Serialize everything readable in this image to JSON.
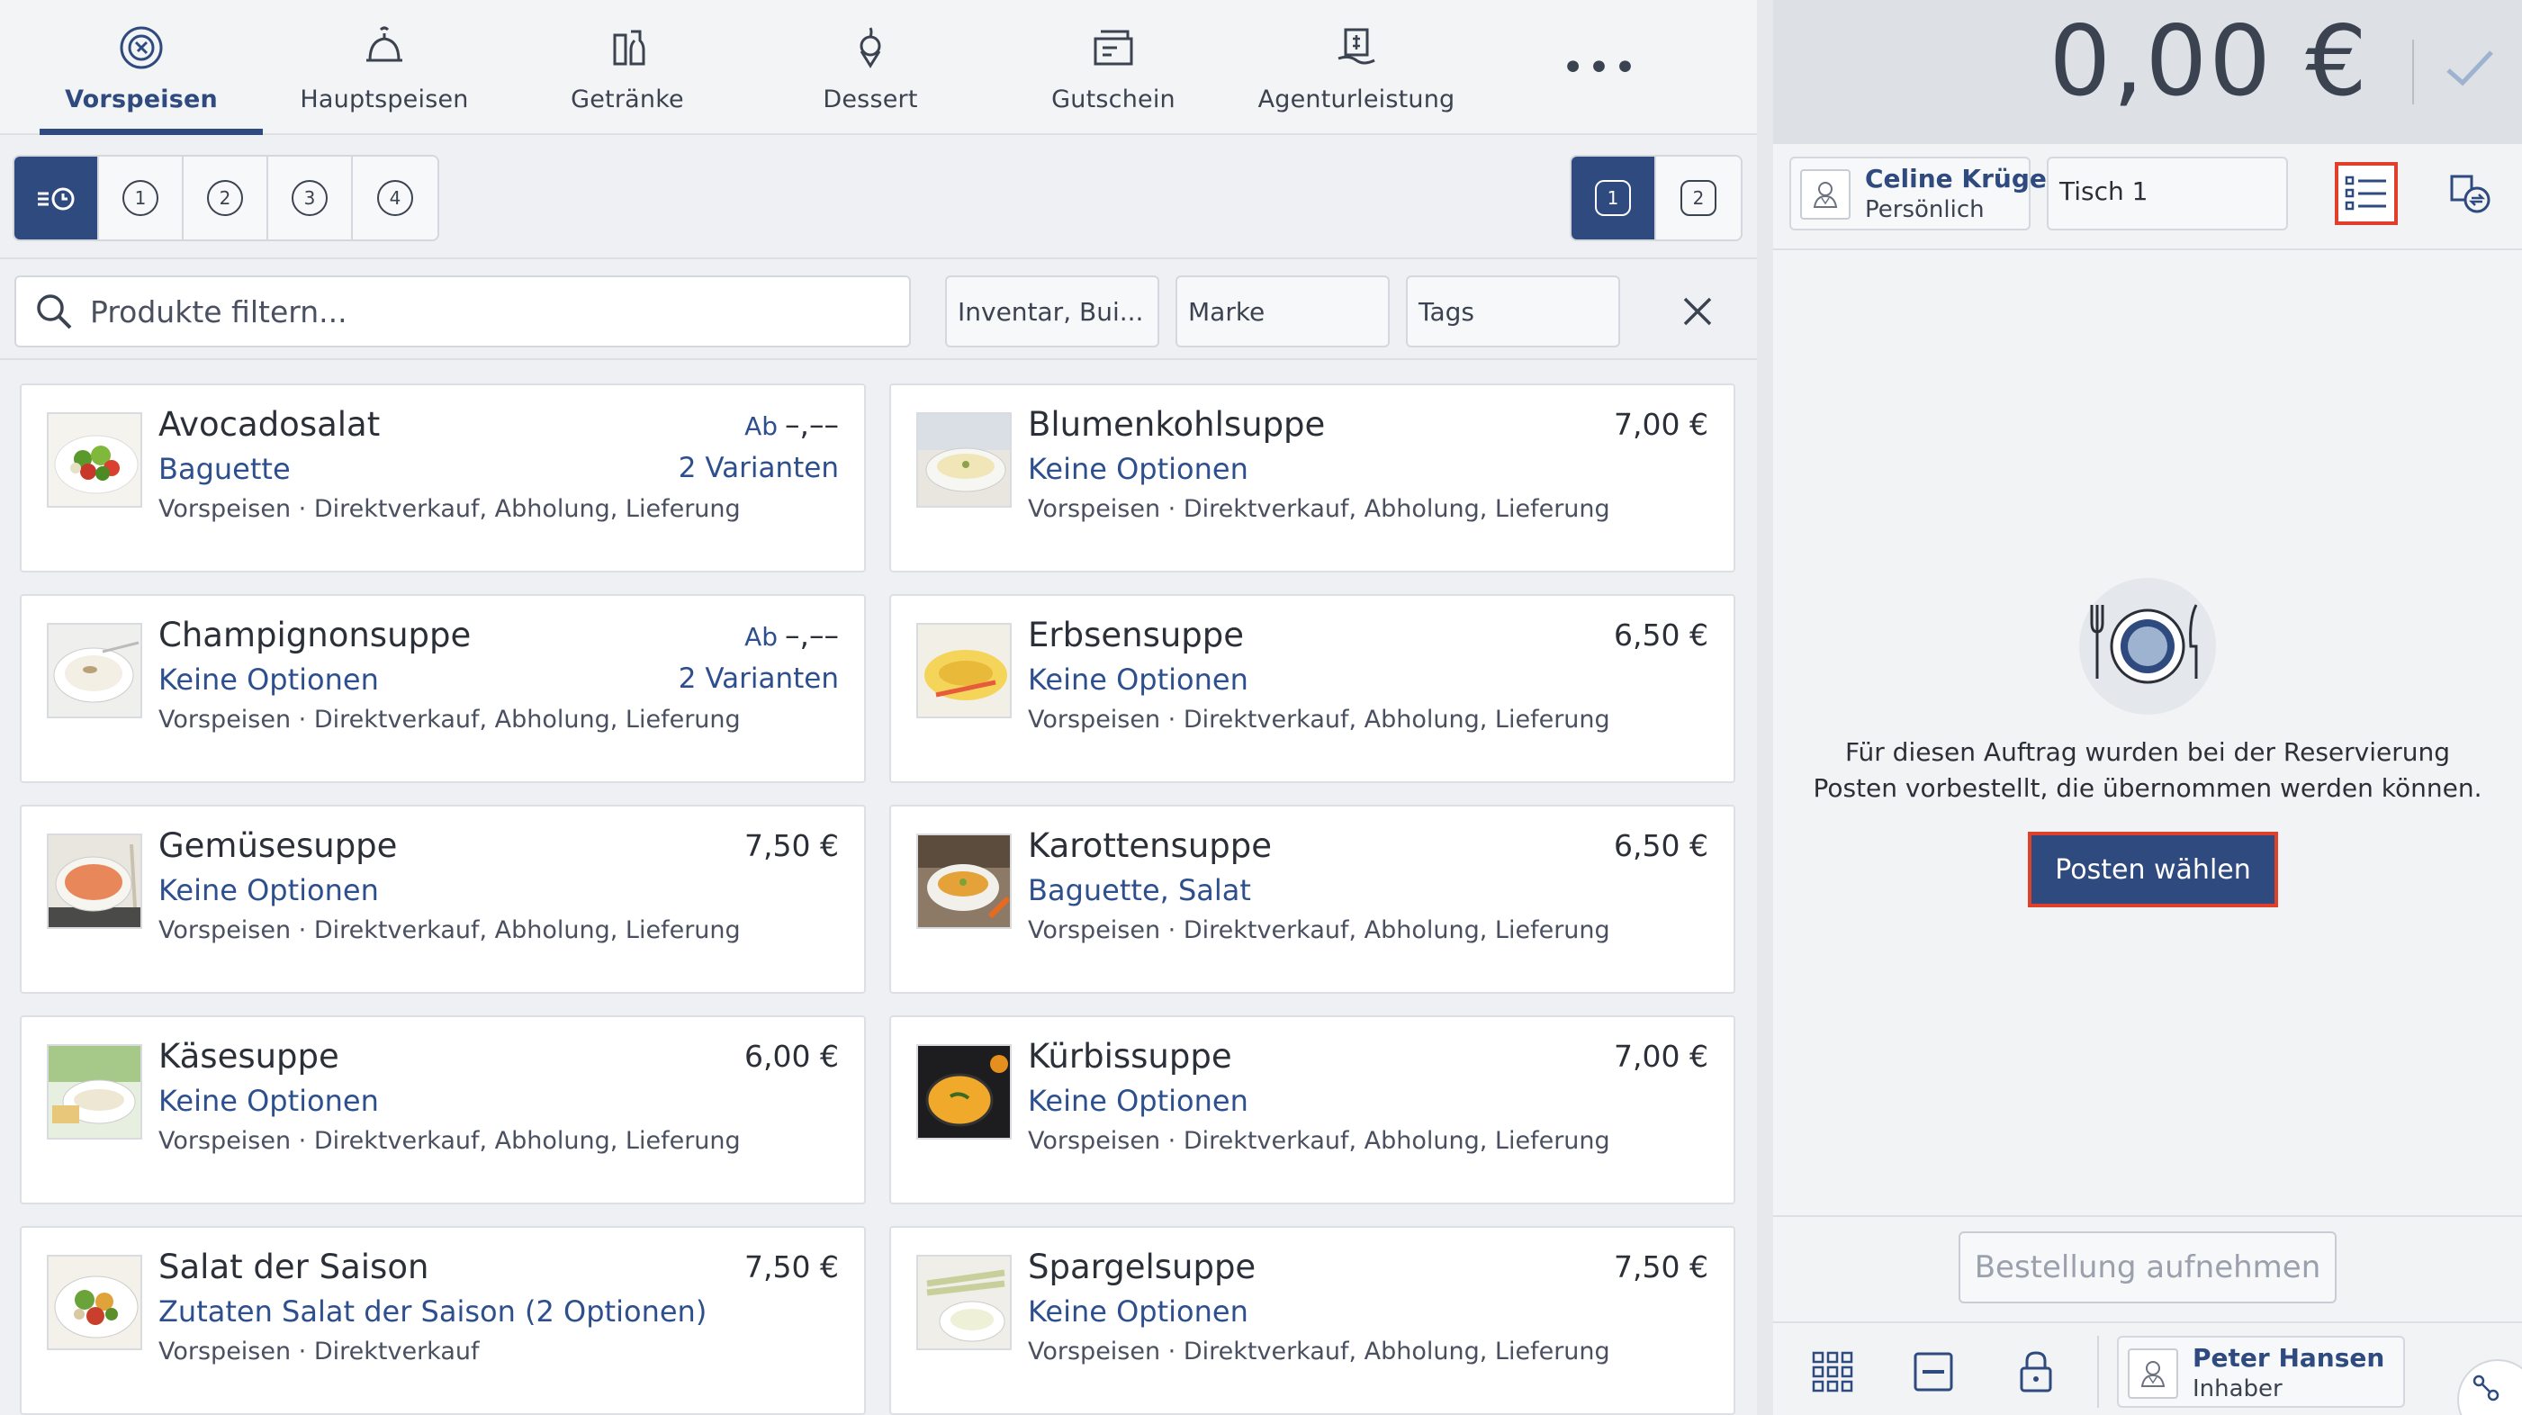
{
  "categories": [
    {
      "label": "Vorspeisen",
      "icon": "plate-icon",
      "active": true
    },
    {
      "label": "Hauptspeisen",
      "icon": "cloche-icon",
      "active": false
    },
    {
      "label": "Getränke",
      "icon": "drinks-icon",
      "active": false
    },
    {
      "label": "Dessert",
      "icon": "dessert-icon",
      "active": false
    },
    {
      "label": "Gutschein",
      "icon": "voucher-icon",
      "active": false
    },
    {
      "label": "Agenturleistung",
      "icon": "agency-service-icon",
      "active": false
    }
  ],
  "more_label": "•••",
  "course_segments": [
    "1",
    "2",
    "3",
    "4"
  ],
  "seat_segments": [
    "1",
    "2"
  ],
  "search": {
    "placeholder": "Produkte filtern..."
  },
  "filters": {
    "inventory": "Inventar, Bui...",
    "brand": "Marke",
    "tags": "Tags"
  },
  "products": [
    {
      "name": "Avocadosalat",
      "options": "Baguette",
      "category": "Vorspeisen · Direktverkauf, Abholung, Lieferung",
      "price_prefix": "Ab",
      "price": "–,––",
      "variants": "2 Varianten"
    },
    {
      "name": "Blumenkohlsuppe",
      "options": "Keine Optionen",
      "category": "Vorspeisen · Direktverkauf, Abholung, Lieferung",
      "price_prefix": "",
      "price": "7,00 €",
      "variants": ""
    },
    {
      "name": "Champignonsuppe",
      "options": "Keine Optionen",
      "category": "Vorspeisen · Direktverkauf, Abholung, Lieferung",
      "price_prefix": "Ab",
      "price": "–,––",
      "variants": "2 Varianten"
    },
    {
      "name": "Erbsensuppe",
      "options": "Keine Optionen",
      "category": "Vorspeisen · Direktverkauf, Abholung, Lieferung",
      "price_prefix": "",
      "price": "6,50 €",
      "variants": ""
    },
    {
      "name": "Gemüsesuppe",
      "options": "Keine Optionen",
      "category": "Vorspeisen · Direktverkauf, Abholung, Lieferung",
      "price_prefix": "",
      "price": "7,50 €",
      "variants": ""
    },
    {
      "name": "Karottensuppe",
      "options": "Baguette, Salat",
      "category": "Vorspeisen · Direktverkauf, Abholung, Lieferung",
      "price_prefix": "",
      "price": "6,50 €",
      "variants": ""
    },
    {
      "name": "Käsesuppe",
      "options": "Keine Optionen",
      "category": "Vorspeisen · Direktverkauf, Abholung, Lieferung",
      "price_prefix": "",
      "price": "6,00 €",
      "variants": ""
    },
    {
      "name": "Kürbissuppe",
      "options": "Keine Optionen",
      "category": "Vorspeisen · Direktverkauf, Abholung, Lieferung",
      "price_prefix": "",
      "price": "7,00 €",
      "variants": ""
    },
    {
      "name": "Salat der Saison",
      "options": "Zutaten Salat der Saison (2 Optionen)",
      "category": "Vorspeisen · Direktverkauf",
      "price_prefix": "",
      "price": "7,50 €",
      "variants": ""
    },
    {
      "name": "Spargelsuppe",
      "options": "Keine Optionen",
      "category": "Vorspeisen · Direktverkauf, Abholung, Lieferung",
      "price_prefix": "",
      "price": "7,50 €",
      "variants": ""
    }
  ],
  "order": {
    "total": "0,00 €",
    "customer_name": "Celine Krüger",
    "customer_type": "Persönlich",
    "table": "Tisch 1",
    "empty_message": "Für diesen Auftrag wurden bei der Reservierung Posten vorbestellt, die übernommen werden können.",
    "choose_items_label": "Posten wählen",
    "place_order_label": "Bestellung aufnehmen"
  },
  "user": {
    "name": "Peter Hansen",
    "role": "Inhaber"
  },
  "colors": {
    "accent": "#2e4a7e",
    "highlight": "#e0402b",
    "link": "#2e4f8e"
  }
}
